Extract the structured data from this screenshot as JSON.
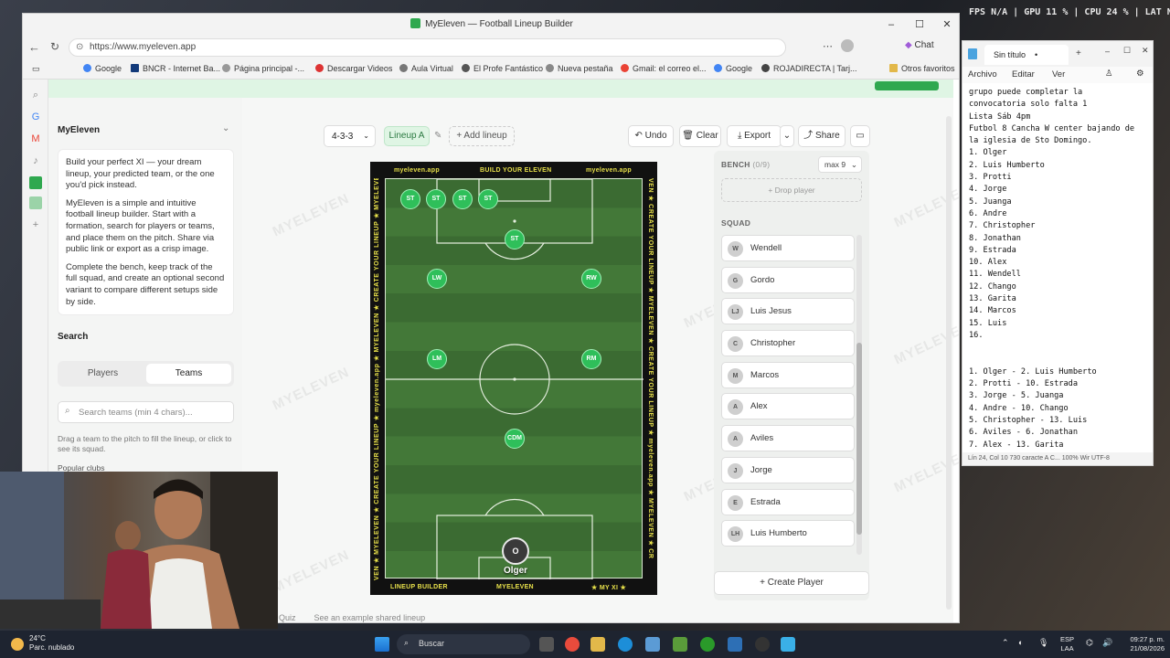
{
  "hud": {
    "text": "FPS N/A  |  GPU 11 %  |  CPU 24 %  |  LAT N/A"
  },
  "browser": {
    "title": "MyEleven — Football Lineup Builder",
    "url": "https://www.myeleven.app",
    "chat_label": "Chat",
    "bookmarks": [
      "Google",
      "BNCR - Internet Ba...",
      "Página principal -...",
      "Descargar Videos",
      "Aula Virtual",
      "El Profe Fantástico",
      "Nueva pestaña",
      "Gmail: el correo el...",
      "Google",
      "ROJADIRECTA | Tarj..."
    ],
    "other_bookmarks": "Otros favoritos"
  },
  "sidebar": {
    "app_name": "MyEleven",
    "desc": [
      "Build your perfect XI — your dream lineup, your predicted team, or the one you'd pick instead.",
      "MyEleven is a simple and intuitive football lineup builder. Start with a formation, search for players or teams, and place them on the pitch. Share via public link or export as a crisp image.",
      "Complete the bench, keep track of the full squad, and create an optional second variant to compare different setups side by side."
    ],
    "search_heading": "Search",
    "tab_players": "Players",
    "tab_teams": "Teams",
    "team_search_placeholder": "Search teams (min 4 chars)...",
    "hint": "Drag a team to the pitch to fill the lineup, or click to see its squad.",
    "popular_clubs": "Popular clubs"
  },
  "toolbar": {
    "formation": "4-3-3",
    "lineup_label": "Lineup A",
    "add_lineup": "+ Add lineup",
    "undo": "Undo",
    "clear": "Clear",
    "export": "Export",
    "share": "Share"
  },
  "pitch": {
    "top_left": "myeleven.app",
    "top_mid": "BUILD YOUR ELEVEN",
    "top_right": "myeleven.app",
    "bottom_left": "LINEUP BUILDER",
    "bottom_mid": "MYELEVEN",
    "bottom_right": "★ MY XI ★",
    "side_left": "VEN ★ MYELEVEN ★ CREATE YOUR LINEUP ★ myeleven.app ★ MYELEVEN ★ CREATE YOUR LINEUP ★ MYELEVEN ★ CR",
    "side_right": "VEN ★ CREATE YOUR LINEUP ★ MYELEVEN ★ CREATE YOUR LINEUP ★ myeleven.app ★ MYELEVEN ★ CR",
    "players": [
      {
        "label": "ST"
      },
      {
        "label": "ST"
      },
      {
        "label": "ST"
      },
      {
        "label": "ST"
      },
      {
        "label": "ST"
      },
      {
        "label": "LW"
      },
      {
        "label": "RW"
      },
      {
        "label": "LM"
      },
      {
        "label": "RM"
      },
      {
        "label": "CDM"
      }
    ],
    "goalkeeper": {
      "initial": "O",
      "name": "Olger"
    }
  },
  "bench": {
    "label": "BENCH",
    "count": "(0/9)",
    "max": "max 9",
    "drop": "+ Drop player"
  },
  "squad": {
    "label": "SQUAD",
    "players": [
      {
        "initials": "W",
        "name": "Wendell"
      },
      {
        "initials": "G",
        "name": "Gordo"
      },
      {
        "initials": "LJ",
        "name": "Luis Jesus"
      },
      {
        "initials": "C",
        "name": "Christopher"
      },
      {
        "initials": "M",
        "name": "Marcos"
      },
      {
        "initials": "A",
        "name": "Alex"
      },
      {
        "initials": "A",
        "name": "Aviles"
      },
      {
        "initials": "J",
        "name": "Jorge"
      },
      {
        "initials": "E",
        "name": "Estrada"
      },
      {
        "initials": "LH",
        "name": "Luis Humberto"
      }
    ],
    "create": "Create Player"
  },
  "footer": {
    "quiz": "Quiz",
    "example": "See an example shared lineup"
  },
  "watermark": "MYELEVEN",
  "notepad": {
    "tab": "Sin título",
    "menu": [
      "Archivo",
      "Editar",
      "Ver"
    ],
    "text": "grupo puede completar la\nconvocatoria solo falta 1\nLista Sáb 4pm\nFutbol 8 Cancha W center bajando de\nla iglesia de Sto Domingo.\n1. Olger\n2. Luis Humberto\n3. Protti\n4. Jorge\n5. Juanga\n6. Andre\n7. Christopher\n8. Jonathan\n9. Estrada\n10. Alex\n11. Wendell\n12. Chango\n13. Garita\n14. Marcos\n15. Luis\n16.\n\n\n1. Olger - 2. Luis Humberto\n2. Protti - 10. Estrada\n3. Jorge - 5. Juanga\n4. Andre - 10. Chango\n5. Christopher - 13. Luis\n6. Aviles - 6. Jonathan\n7. Alex - 13. Garita\n8. Wendell - 14. Marcos",
    "status": "Lín 24, Col 10   730 caracte  A    C...   100%   Wir   UTF-8"
  },
  "taskbar": {
    "temp": "24°C",
    "weather": "Parc. nublado",
    "search": "Buscar",
    "lang1": "ESP",
    "lang2": "LAA",
    "time": "09:27 p. m.",
    "date": "21/08/2026"
  }
}
